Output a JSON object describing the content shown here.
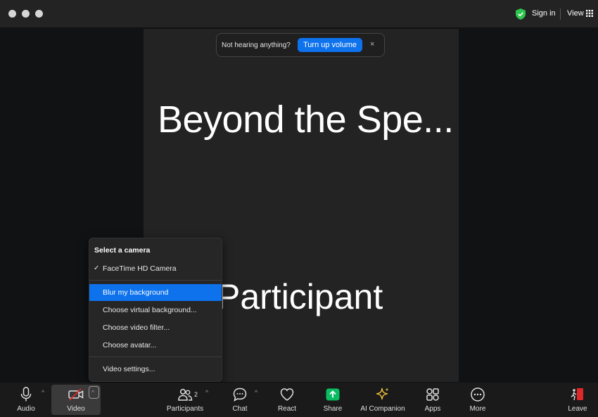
{
  "titlebar": {
    "signin": "Sign in",
    "view": "View"
  },
  "toast": {
    "message": "Not hearing anything?",
    "button": "Turn up volume",
    "close": "×"
  },
  "tile": {
    "title": "Beyond the Spe...",
    "name": "Participant"
  },
  "camera_menu": {
    "header": "Select a camera",
    "check": "✓",
    "camera": "FaceTime HD Camera",
    "options": [
      "Blur my background",
      "Choose virtual background...",
      "Choose video filter...",
      "Choose avatar..."
    ],
    "settings": "Video settings..."
  },
  "toolbar": {
    "audio": "Audio",
    "video": "Video",
    "participants": "Participants",
    "participant_count": "2",
    "chat": "Chat",
    "react": "React",
    "share": "Share",
    "ai_companion": "AI Companion",
    "apps": "Apps",
    "more": "More",
    "leave": "Leave"
  },
  "colors": {
    "accent": "#0e72ed",
    "share_green": "#0bbd62",
    "leave_red": "#e02828",
    "ai_gold": "#f4c43c",
    "shield_green": "#2dc54d"
  }
}
